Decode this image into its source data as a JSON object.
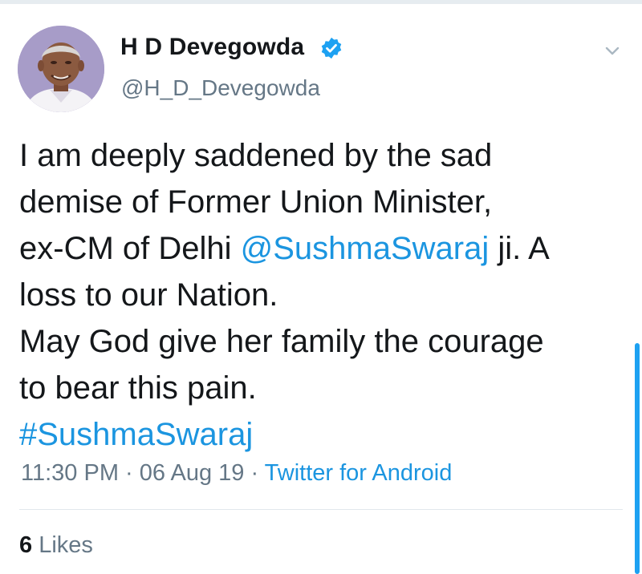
{
  "tweet": {
    "author": {
      "display_name": "H D Devegowda",
      "handle": "@H_D_Devegowda",
      "verified_icon": "verified-badge-icon",
      "avatar": "profile-photo"
    },
    "menu_icon": "chevron-down-icon",
    "body": {
      "line1": "I am deeply saddened by the sad",
      "line2": "demise of Former Union Minister,",
      "line3_prefix": "ex-CM of Delhi ",
      "line3_mention": "@SushmaSwaraj",
      "line3_suffix": " ji. A",
      "line4": "loss to our Nation.",
      "line5": "May God give her family the courage",
      "line6": "to bear this pain.",
      "hashtag": "#SushmaSwaraj"
    },
    "meta": {
      "time": "11:30 PM",
      "separator": " · ",
      "date": "06 Aug 19",
      "source": "Twitter for Android"
    },
    "stats": {
      "likes_count": "6",
      "likes_label": " Likes"
    }
  },
  "colors": {
    "link": "#1b95e0",
    "verified": "#1da1f2",
    "muted": "#657786",
    "text": "#14171a",
    "divider": "#e1e8ed"
  }
}
